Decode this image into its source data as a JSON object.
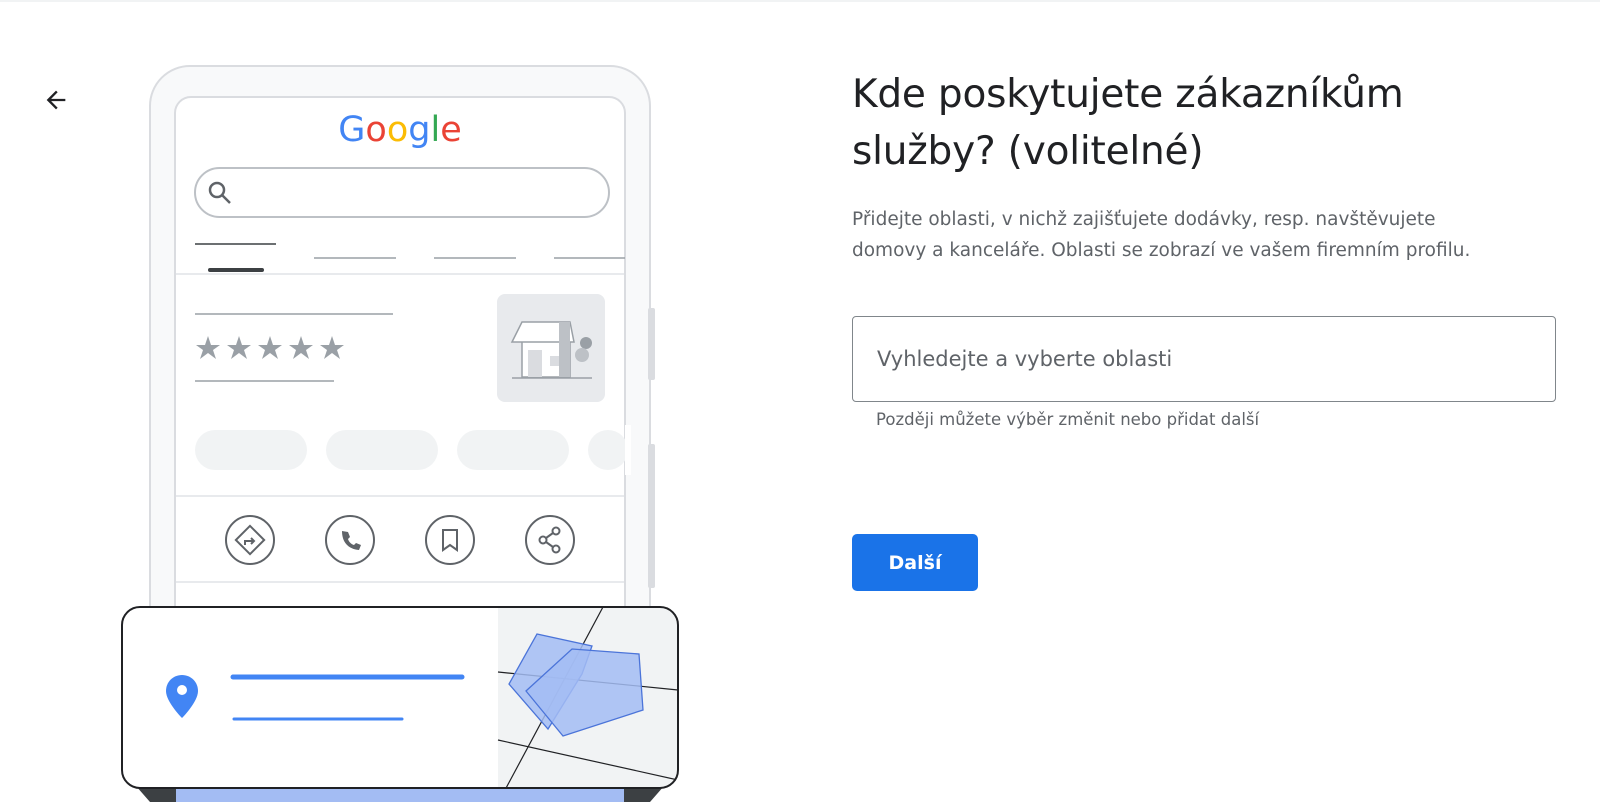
{
  "header": {
    "back_icon": "arrow-left-icon"
  },
  "illustration": {
    "brand": "Google",
    "brand_colors": [
      "#4285f4",
      "#ea4335",
      "#fbbc05",
      "#4285f4",
      "#34a853",
      "#ea4335"
    ],
    "rating_stars": 5,
    "action_icons": [
      "directions-icon",
      "phone-icon",
      "bookmark-icon",
      "share-icon"
    ],
    "pin_color": "#4285f4",
    "area_fill": "#a3bcf3",
    "area_stroke": "#4b74d9"
  },
  "main": {
    "title_line1": "Kde poskytujete zákazníkům",
    "title_line2": "služby? (volitelné)",
    "desc_line1": "Přidejte oblasti, v nichž zajišťujete dodávky, resp. navštěvujete",
    "desc_line2": "domovy a kanceláře. Oblasti se zobrazí ve vašem firemním profilu.",
    "search": {
      "value": "",
      "placeholder": "Vyhledejte a vyberte oblasti"
    },
    "helper_text": "Později můžete výběr změnit nebo přidat další",
    "next_label": "Další"
  },
  "colors": {
    "accent": "#1a73e8",
    "text_primary": "#202124",
    "text_secondary": "#5f6368"
  }
}
